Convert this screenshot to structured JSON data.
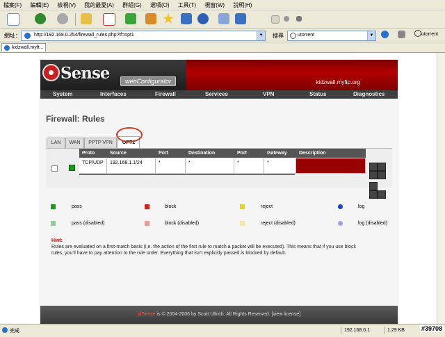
{
  "menubar": [
    "檔案(F)",
    "編輯(E)",
    "檢視(V)",
    "我的最愛(A)",
    "群組(G)",
    "選項(O)",
    "工具(T)",
    "視窗(W)",
    "說明(H)"
  ],
  "address": {
    "label": "網址：",
    "url": "http://192.168.0.254/firewall_rules.php?if=opt1"
  },
  "search": {
    "label": "搜尋",
    "value": "utorrent",
    "right_value": "utorrent"
  },
  "browser_tab": {
    "title": "kidzwall.myft..."
  },
  "header": {
    "brand": "Sense",
    "subtitle": "webConfigurator",
    "domain": "kidzwall.myftp.org"
  },
  "nav": [
    "System",
    "Interfaces",
    "Firewall",
    "Services",
    "VPN",
    "Status",
    "Diagnostics"
  ],
  "page_title": "Firewall: Rules",
  "tabs": [
    {
      "label": "LAN",
      "active": false
    },
    {
      "label": "WAN",
      "active": false
    },
    {
      "label": "PPTP VPN",
      "active": false
    },
    {
      "label": "OPT1",
      "active": true
    }
  ],
  "table": {
    "headers": [
      "Proto",
      "Source",
      "Port",
      "Destination",
      "Port",
      "Gateway",
      "Description"
    ],
    "row": {
      "proto": "TCP/UDP",
      "source": "192.168.1.1/24",
      "port": "*",
      "destination": "*",
      "dport": "*",
      "gateway": "*",
      "description": ""
    }
  },
  "legend": {
    "pass": "pass",
    "block": "block",
    "reject": "reject",
    "log": "log",
    "pass_disabled": "pass (disabled)",
    "block_disabled": "block (disabled)",
    "reject_disabled": "reject (disabled)",
    "log_disabled": "log (disabled)"
  },
  "hint": {
    "title": "Hint:",
    "text": "Rules are evaluated on a first-match basis (i.e. the action of the first rule to match a packet will be executed). This means that if you use block rules, you'll have to pay attention to the rule order. Everything that isn't explicitly passed is blocked by default."
  },
  "footer": {
    "brand": "pfSense",
    "text": " is © 2004-2006 by Scott Ullrich. All Rights Reserved. [view license]"
  },
  "status": {
    "left": "完成",
    "ip": "192.168.0.1",
    "size": "1.29 KB",
    "watermark": "#39708"
  },
  "colors": {
    "banner_red": "#990000",
    "nav_dark": "#3f3f3f",
    "pass_green": "#1a9c1a",
    "block_red": "#cc2222",
    "reject_yellow": "#e8d22a",
    "log_blue": "#1e3fcf"
  }
}
